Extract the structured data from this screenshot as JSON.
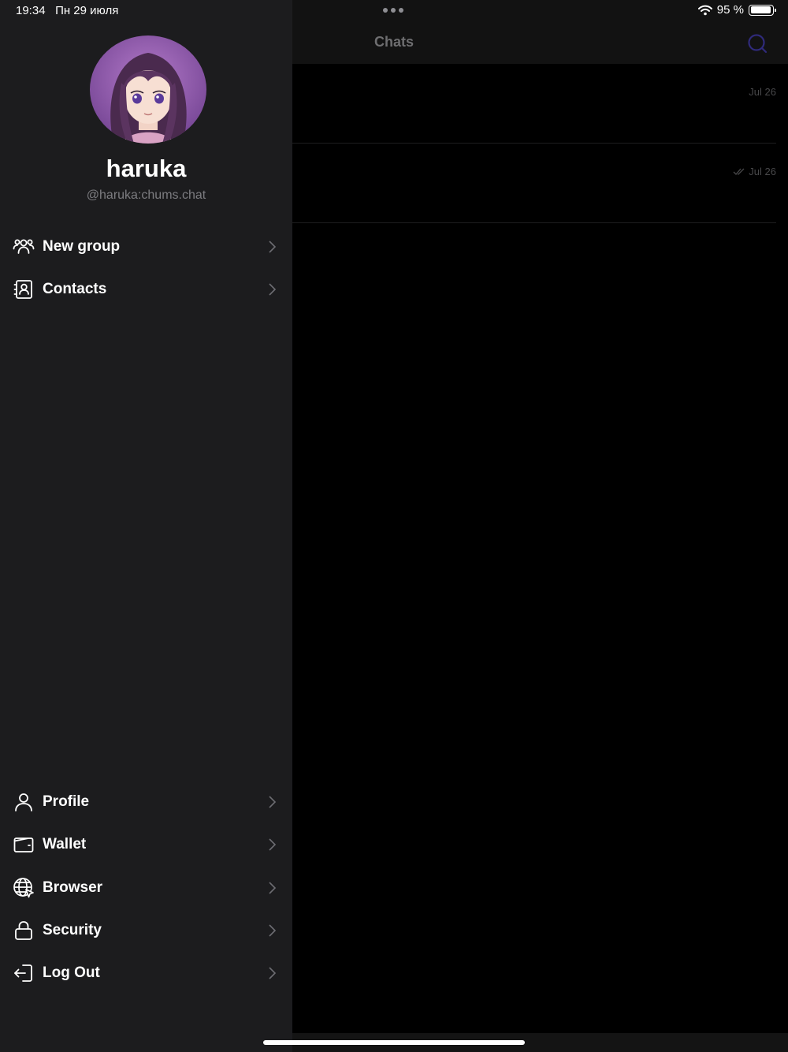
{
  "status_bar": {
    "time": "19:34",
    "date": "Пн 29 июля",
    "battery_text": "95 %",
    "battery_level": 0.95
  },
  "main": {
    "title": "Chats",
    "chats": [
      {
        "date": "Jul 26",
        "read": false
      },
      {
        "date": "Jul 26",
        "read": true
      }
    ],
    "search_icon": "search-icon",
    "accent_color": "#2f2a7a"
  },
  "drawer": {
    "user": {
      "name": "haruka",
      "handle": "@haruka:chums.chat"
    },
    "top_items": [
      {
        "label": "New group",
        "icon": "group-icon"
      },
      {
        "label": "Contacts",
        "icon": "contacts-icon"
      }
    ],
    "bottom_items": [
      {
        "label": "Profile",
        "icon": "person-icon"
      },
      {
        "label": "Wallet",
        "icon": "wallet-icon"
      },
      {
        "label": "Browser",
        "icon": "globe-icon"
      },
      {
        "label": "Security",
        "icon": "lock-icon"
      },
      {
        "label": "Log Out",
        "icon": "logout-icon"
      }
    ]
  }
}
